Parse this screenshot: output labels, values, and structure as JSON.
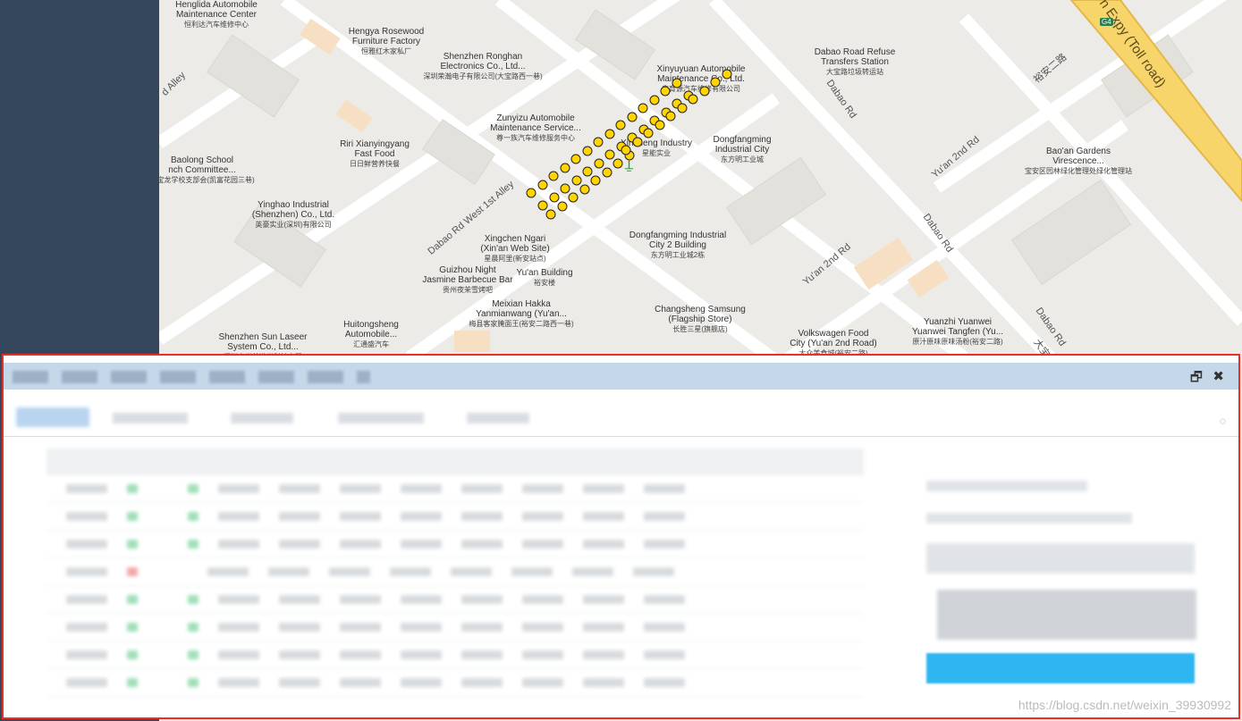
{
  "map": {
    "pois": [
      {
        "name": "Henglida Automobile",
        "name2": "Maintenance Center",
        "zh": "恒利达汽车维修中心"
      },
      {
        "name": "Hengya Rosewood",
        "name2": "Furniture Factory",
        "zh": "恒雅红木家私厂"
      },
      {
        "name": "Shenzhen Ronghan",
        "name2": "Electronics Co., Ltd...",
        "zh": "深圳荣瀚电子有限公司(大宝路西一巷)"
      },
      {
        "name": "Xinyuyuan Automobile",
        "name2": "Maintenance Co., Ltd.",
        "zh": "鑫育源汽车维修有限公司"
      },
      {
        "name": "Dabao Road Refuse",
        "name2": "Transfers Station",
        "zh": "大宝路垃圾转运站"
      },
      {
        "name": "Zunyizu Automobile",
        "name2": "Maintenance Service...",
        "zh": "尊一族汽车维修服务中心"
      },
      {
        "name": "Riri Xianyingyang",
        "name2": "Fast Food",
        "zh": "日日鲜营养快餐"
      },
      {
        "name": "Xincheng Industry",
        "name2": "",
        "zh": "星能实业"
      },
      {
        "name": "Dongfangming",
        "name2": "Industrial City",
        "zh": "东方明工业城"
      },
      {
        "name": "Baolong School",
        "name2": "nch Committee...",
        "zh": "共宝龙学校支部会(凯富花园三巷)"
      },
      {
        "name": "Bao'an Gardens",
        "name2": "Virescence...",
        "zh": "宝安区园林绿化管理处绿化管理站"
      },
      {
        "name": "Yinghao Industrial",
        "name2": "(Shenzhen) Co., Ltd.",
        "zh": "英豪实业(深圳)有限公司"
      },
      {
        "name": "Dongfangming Industrial",
        "name2": "City 2 Building",
        "zh": "东方明工业城2栋"
      },
      {
        "name": "Xingchen Ngari",
        "name2": "(Xin'an Web Site)",
        "zh": "星晨阿里(新安站点)"
      },
      {
        "name": "Guizhou Night",
        "name2": "Jasmine Barbecue Bar",
        "zh": "贵州夜茉雪烤吧"
      },
      {
        "name": "Yu'an Building",
        "name2": "",
        "zh": "裕安楼"
      },
      {
        "name": "Meixian Hakka",
        "name2": "Yanmianwang (Yu'an...",
        "zh": "梅县客家腌面王(裕安二路西一巷)"
      },
      {
        "name": "Changsheng Samsung",
        "name2": "(Flagship Store)",
        "zh": "长胜三星(旗舰店)"
      },
      {
        "name": "Huitongsheng",
        "name2": "Automobile...",
        "zh": "汇通盛汽车"
      },
      {
        "name": "Shenzhen Sun Laseer",
        "name2": "System Co., Ltd...",
        "zh": "深圳市光普激光科技有限"
      },
      {
        "name": "Volkswagen Food",
        "name2": "City (Yu'an 2nd Road)",
        "zh": "大众美食城(裕安二路)"
      },
      {
        "name": "Yuanzhi Yuanwei",
        "name2": "Yuanwei Tangfen (Yu...",
        "zh": "原汁原味原味汤粉(裕安二路)"
      }
    ],
    "roads": {
      "dabao_rd_1": "Dabao Rd",
      "dabao_rd_2": "Dabao Rd",
      "dabao_rd_3": "Dabao Rd",
      "yuan_2nd_1": "Yu'an 2nd Rd",
      "yuan_2nd_2": "Yu'an 2nd Rd",
      "dabao_west": "Dabao Rd West 1st Alley",
      "alley": "d Alley",
      "zh_road": "裕安二路",
      "zh_road2": "大宝路",
      "expressway": "n Expy (Toll road)",
      "shield": "G4"
    },
    "marker_rows": [
      {
        "count": 14,
        "start": [
          594,
          216
        ],
        "step": [
          12.5,
          -9.5
        ]
      },
      {
        "count": 14,
        "start": [
          607,
          230
        ],
        "step": [
          12.5,
          -9.5
        ]
      },
      {
        "count": 8,
        "start": [
          616,
          240
        ],
        "step": [
          12.5,
          -9.5
        ]
      },
      {
        "count": 10,
        "start": [
          700,
          168
        ],
        "step": [
          12.5,
          -9.5
        ]
      }
    ],
    "antenna_icon": "antenna-tower-icon"
  },
  "sidebar": {
    "collapse_glyph": "‹"
  },
  "panel": {
    "restore_glyph": "🗗",
    "close_glyph": "✖",
    "spinner_glyph": "◌",
    "tab_count": 5,
    "row_status": [
      "green",
      "green",
      "green",
      "red",
      "green",
      "green",
      "green",
      "green"
    ]
  },
  "watermark": "https://blog.csdn.net/weixin_39930992"
}
